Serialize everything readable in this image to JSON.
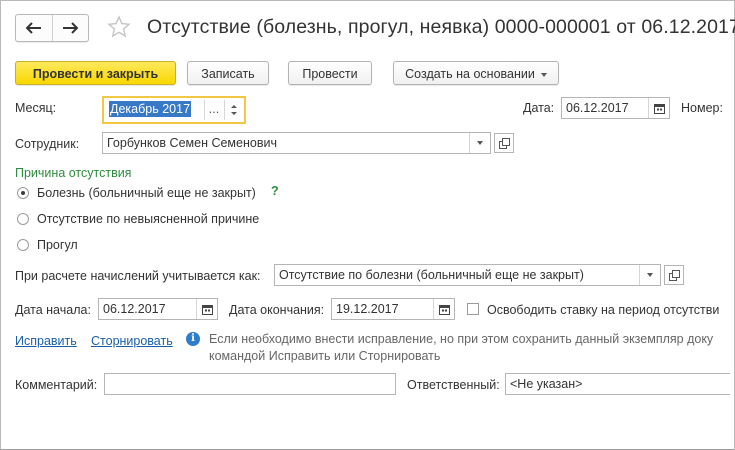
{
  "window": {
    "title": "Отсутствие (болезнь, прогул, неявка) 0000-000001 от 06.12.2017"
  },
  "toolbar": {
    "post_close_label": "Провести и закрыть",
    "save_label": "Записать",
    "post_label": "Провести",
    "create_based_label": "Создать на основании"
  },
  "form": {
    "month_label": "Месяц:",
    "month_value": "Декабрь 2017",
    "month_dots": "...",
    "date_label": "Дата:",
    "date_value": "06.12.2017",
    "number_label": "Номер:",
    "employee_label": "Сотрудник:",
    "employee_value": "Горбунков Семен Семенович",
    "reason_header": "Причина отсутствия",
    "reason_options": [
      {
        "label": "Болезнь (больничный еще не закрыт)",
        "selected": true
      },
      {
        "label": "Отсутствие по невыясненной причине",
        "selected": false
      },
      {
        "label": "Прогул",
        "selected": false
      }
    ],
    "help_mark": "?",
    "accrual_label": "При расчете начислений учитывается как:",
    "accrual_value": "Отсутствие по болезни (больничный еще не закрыт)",
    "start_label": "Дата начала:",
    "start_value": "06.12.2017",
    "end_label": "Дата окончания:",
    "end_value": "19.12.2017",
    "release_rate_label": "Освободить ставку на период отсутстви",
    "release_rate_checked": false,
    "fix_link": "Исправить",
    "storno_link": "Сторнировать",
    "info_icon": "i",
    "info_text_line1": "Если необходимо внести исправление, но при этом сохранить данный экземпляр доку",
    "info_text_line2": "командой Исправить или Сторнировать",
    "comment_label": "Комментарий:",
    "comment_value": "",
    "responsible_label": "Ответственный:",
    "responsible_value": "<Не указан>"
  },
  "colors": {
    "primary_button": "#f8d700",
    "link": "#1a5fa8",
    "section_header": "#2e8b3e",
    "focus_border": "#f2c744",
    "selection": "#3778c7",
    "info_icon": "#2f7ec8"
  },
  "icons": [
    "arrow-left-icon",
    "arrow-right-icon",
    "star-icon",
    "calendar-icon",
    "dropdown-icon",
    "open-form-icon",
    "info-icon"
  ]
}
